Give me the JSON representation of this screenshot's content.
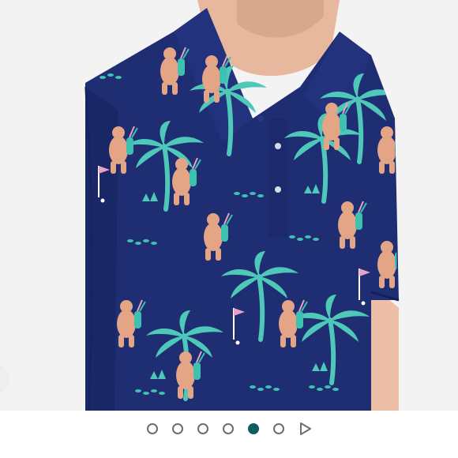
{
  "carousel": {
    "slide_count": 6,
    "active_index": 4,
    "accent_color": "#0f5c62",
    "dot_color": "#6e6e6e",
    "next_icon": "play-triangle-icon"
  },
  "photo": {
    "shirt_color": "#1f2d73",
    "print_teal": "#3fc1b1",
    "print_skin": "#e3a586",
    "print_pink": "#e9a2c7"
  }
}
